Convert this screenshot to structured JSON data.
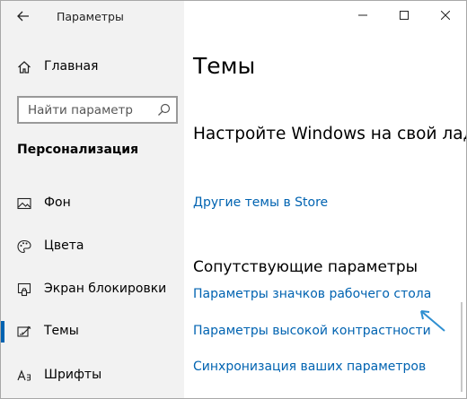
{
  "window": {
    "title": "Параметры",
    "controls": {
      "minimize_icon": "minimize-icon",
      "maximize_icon": "maximize-icon",
      "close_icon": "close-icon"
    }
  },
  "sidebar": {
    "home_label": "Главная",
    "search_placeholder": "Найти параметр",
    "section_label": "Персонализация",
    "items": [
      {
        "label": "Фон",
        "icon": "picture-icon",
        "active": false
      },
      {
        "label": "Цвета",
        "icon": "palette-icon",
        "active": false
      },
      {
        "label": "Экран блокировки",
        "icon": "lock-screen-icon",
        "active": false
      },
      {
        "label": "Темы",
        "icon": "themes-icon",
        "active": true
      },
      {
        "label": "Шрифты",
        "icon": "font-icon",
        "active": false
      }
    ]
  },
  "main": {
    "title": "Темы",
    "subtitle": "Настройте Windows на свой лад",
    "store_link": "Другие темы в Store",
    "related_heading": "Сопутствующие параметры",
    "related_links": [
      "Параметры значков рабочего стола",
      "Параметры высокой контрастности",
      "Синхронизация ваших параметров"
    ]
  },
  "colors": {
    "accent": "#0063b1",
    "sidebar_bg": "#f2f2f2",
    "annotation_arrow": "#2e8fd1"
  }
}
